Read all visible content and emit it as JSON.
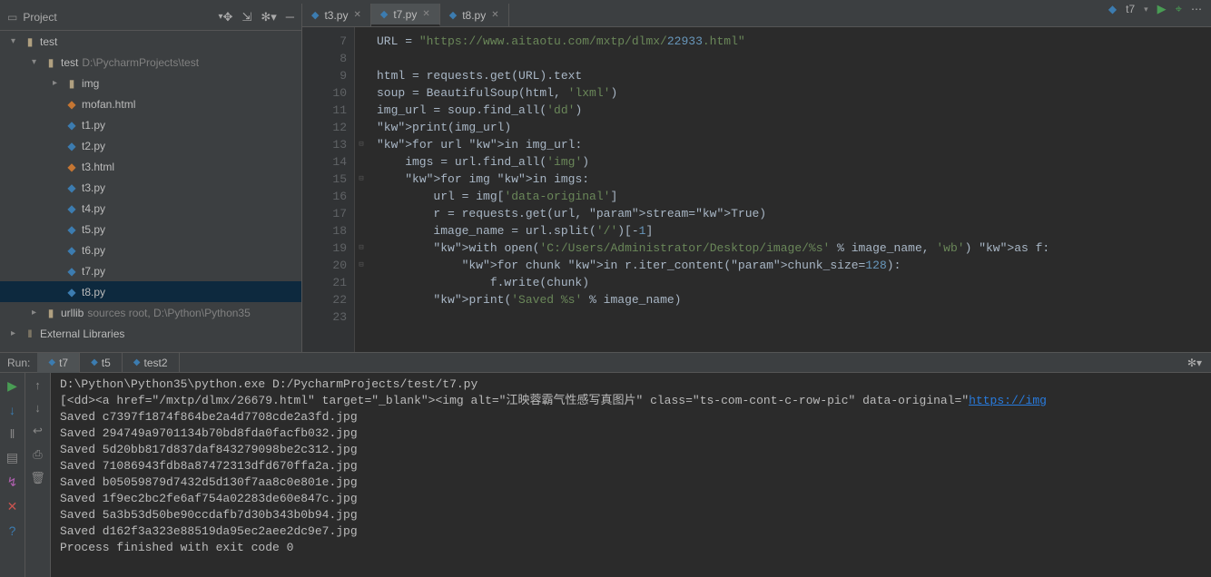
{
  "topRight": {
    "config": "t7"
  },
  "sidebar": {
    "title": "Project",
    "projectRoot": "test",
    "tree": [
      {
        "depth": 1,
        "arrow": "▾",
        "icon": "folder",
        "label": "test",
        "gray": ""
      },
      {
        "depth": 2,
        "arrow": "▾",
        "icon": "folder",
        "label": "test",
        "gray": "D:\\PycharmProjects\\test"
      },
      {
        "depth": 3,
        "arrow": "▸",
        "icon": "folder",
        "label": "img",
        "gray": ""
      },
      {
        "depth": 3,
        "arrow": "",
        "icon": "html",
        "label": "mofan.html",
        "gray": ""
      },
      {
        "depth": 3,
        "arrow": "",
        "icon": "py",
        "label": "t1.py",
        "gray": ""
      },
      {
        "depth": 3,
        "arrow": "",
        "icon": "py",
        "label": "t2.py",
        "gray": ""
      },
      {
        "depth": 3,
        "arrow": "",
        "icon": "html",
        "label": "t3.html",
        "gray": ""
      },
      {
        "depth": 3,
        "arrow": "",
        "icon": "py",
        "label": "t3.py",
        "gray": ""
      },
      {
        "depth": 3,
        "arrow": "",
        "icon": "py",
        "label": "t4.py",
        "gray": ""
      },
      {
        "depth": 3,
        "arrow": "",
        "icon": "py",
        "label": "t5.py",
        "gray": ""
      },
      {
        "depth": 3,
        "arrow": "",
        "icon": "py",
        "label": "t6.py",
        "gray": ""
      },
      {
        "depth": 3,
        "arrow": "",
        "icon": "py",
        "label": "t7.py",
        "gray": ""
      },
      {
        "depth": 3,
        "arrow": "",
        "icon": "py",
        "label": "t8.py",
        "gray": "",
        "selected": true
      },
      {
        "depth": 2,
        "arrow": "▸",
        "icon": "folder",
        "label": "urllib",
        "gray": "sources root,  D:\\Python\\Python35"
      },
      {
        "depth": 1,
        "arrow": "▸",
        "icon": "lib",
        "label": "External Libraries",
        "gray": ""
      }
    ]
  },
  "tabs": [
    {
      "label": "t3.py",
      "active": false
    },
    {
      "label": "t7.py",
      "active": true
    },
    {
      "label": "t8.py",
      "active": false
    }
  ],
  "code": {
    "startLine": 7,
    "lines": [
      "URL = \"https://www.aitaotu.com/mxtp/dlmx/22933.html\"",
      "",
      "html = requests.get(URL).text",
      "soup = BeautifulSoup(html, 'lxml')",
      "img_url = soup.find_all('dd')",
      "print(img_url)",
      "for url in img_url:",
      "    imgs = url.find_all('img')",
      "    for img in imgs:",
      "        url = img['data-original']",
      "        r = requests.get(url, stream=True)",
      "        image_name = url.split('/')[-1]",
      "        with open('C:/Users/Administrator/Desktop/image/%s' % image_name, 'wb') as f:",
      "            for chunk in r.iter_content(chunk_size=128):",
      "                f.write(chunk)",
      "        print('Saved %s' % image_name)"
    ]
  },
  "run": {
    "label": "Run:",
    "tabs": [
      {
        "label": "t7",
        "active": true
      },
      {
        "label": "t5",
        "active": false
      },
      {
        "label": "test2",
        "active": false
      }
    ],
    "output": [
      "D:\\Python\\Python35\\python.exe D:/PycharmProjects/test/t7.py",
      "[<dd><a href=\"/mxtp/dlmx/26679.html\" target=\"_blank\"><img alt=\"江映蓉霸气性感写真图片\" class=\"ts-com-cont-c-row-pic\" data-original=\"https://img",
      "Saved c7397f1874f864be2a4d7708cde2a3fd.jpg",
      "Saved 294749a9701134b70bd8fda0facfb032.jpg",
      "Saved 5d20bb817d837daf843279098be2c312.jpg",
      "Saved 71086943fdb8a87472313dfd670ffa2a.jpg",
      "Saved b05059879d7432d5d130f7aa8c0e801e.jpg",
      "Saved 1f9ec2bc2fe6af754a02283de60e847c.jpg",
      "Saved 5a3b53d50be90ccdafb7d30b343b0b94.jpg",
      "Saved d162f3a323e88519da95ec2aee2dc9e7.jpg",
      "",
      "Process finished with exit code 0"
    ]
  }
}
